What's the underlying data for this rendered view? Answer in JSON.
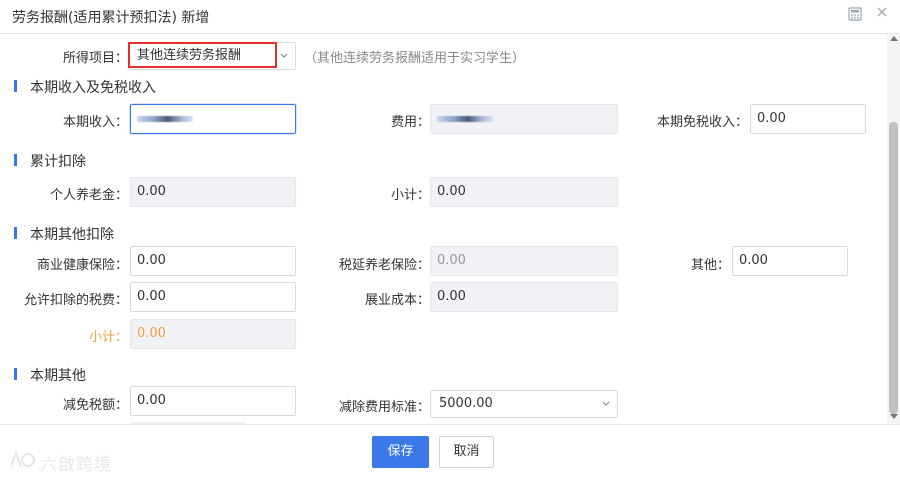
{
  "dialog": {
    "title": "劳务报酬(适用累计预扣法) 新增",
    "icons": {
      "calculator": "calculator-icon",
      "close": "close-icon"
    }
  },
  "income_item": {
    "label": "所得项目：",
    "value": "其他连续劳务报酬",
    "hint": "（其他连续劳务报酬适用于实习学生）"
  },
  "sections": {
    "income": "本期收入及免税收入",
    "cumulative": "累计扣除",
    "other_deductions": "本期其他扣除",
    "other": "本期其他"
  },
  "income_fields": {
    "current_income_label": "本期收入：",
    "expense_label": "费用：",
    "tax_free_label": "本期免税收入：",
    "tax_free_value": "0.00"
  },
  "cumulative_fields": {
    "pension_label": "个人养老金：",
    "pension_value": "0.00",
    "subtotal_label": "小计：",
    "subtotal_value": "0.00"
  },
  "other_deduction_fields": {
    "health_label": "商业健康保险：",
    "health_value": "0.00",
    "deferred_pension_label": "税延养老保险：",
    "deferred_pension_value": "0.00",
    "other_label": "其他：",
    "other_value": "0.00",
    "tax_fee_label": "允许扣除的税费：",
    "tax_fee_value": "0.00",
    "exhibition_label": "展业成本：",
    "exhibition_value": "0.00",
    "subtotal_label": "小计：",
    "subtotal_value": "0.00"
  },
  "other_fields": {
    "tax_relief_label": "减免税额：",
    "tax_relief_value": "0.00",
    "standard_label": "减除费用标准：",
    "standard_value": "5000.00"
  },
  "footer": {
    "save": "保存",
    "cancel": "取消"
  },
  "watermark": "六啟跨境",
  "colors": {
    "primary": "#3b78e7",
    "highlight": "#e0322b",
    "orange": "#f0a040"
  }
}
